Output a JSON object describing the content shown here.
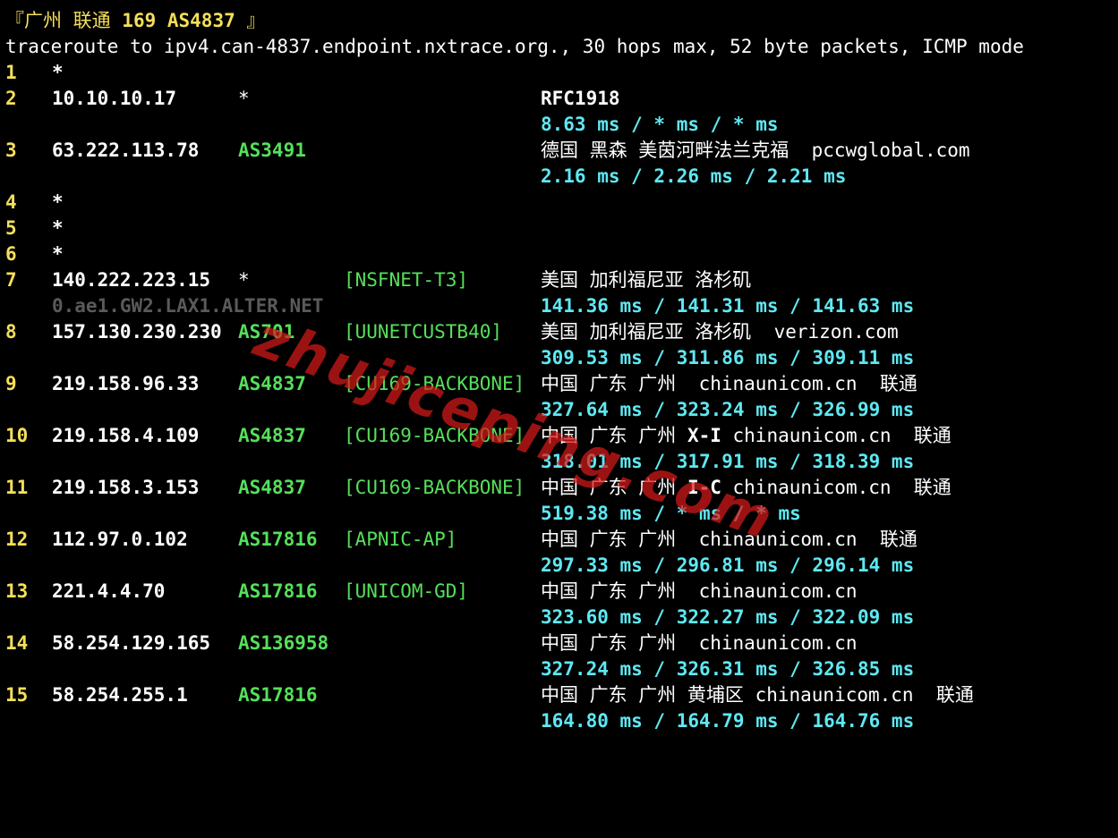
{
  "title": {
    "prefix": "『广州 联通 ",
    "bold": "169 AS4837",
    "suffix": " 』"
  },
  "header": "traceroute to ipv4.can-4837.endpoint.nxtrace.org., 30 hops max, 52 byte packets, ICMP mode",
  "watermark": "zhujiceping.com",
  "colors": {
    "hop_number": "#f5df5a",
    "asn": "#55e05a",
    "rtt": "#5ee8f2",
    "rdns": "#5a5a5a",
    "watermark": "#d71919"
  },
  "hops": [
    {
      "n": "1",
      "ip": "*"
    },
    {
      "n": "2",
      "ip": "10.10.10.17",
      "col2": "*",
      "label": "RFC1918",
      "rtt": "8.63 ms / * ms / * ms"
    },
    {
      "n": "3",
      "ip": "63.222.113.78",
      "asn": "AS3491",
      "geo": "德国 黑森 美茵河畔法兰克福  pccwglobal.com",
      "rtt": "2.16 ms / 2.26 ms / 2.21 ms"
    },
    {
      "n": "4",
      "ip": "*"
    },
    {
      "n": "5",
      "ip": "*"
    },
    {
      "n": "6",
      "ip": "*"
    },
    {
      "n": "7",
      "ip": "140.222.223.15",
      "col2": "*",
      "tag": "[NSFNET-T3]",
      "geo": "美国 加利福尼亚 洛杉矶",
      "rdns": "0.ae1.GW2.LAX1.ALTER.NET",
      "rtt": "141.36 ms / 141.31 ms / 141.63 ms"
    },
    {
      "n": "8",
      "ip": "157.130.230.230",
      "asn": "AS701",
      "tag": "[UUNETCUSTB40]",
      "geo": "美国 加利福尼亚 洛杉矶  verizon.com",
      "rtt": "309.53 ms / 311.86 ms / 309.11 ms"
    },
    {
      "n": "9",
      "ip": "219.158.96.33",
      "asn": "AS4837",
      "tag": "[CU169-BACKBONE]",
      "geo": "中国 广东 广州  chinaunicom.cn  联通",
      "rtt": "327.64 ms / 323.24 ms / 326.99 ms"
    },
    {
      "n": "10",
      "ip": "219.158.4.109",
      "asn": "AS4837",
      "tag": "[CU169-BACKBONE]",
      "geo_pre": "中国 广东 广州 ",
      "geo_bold": "X-I",
      "geo_post": " chinaunicom.cn  联通",
      "rtt": "318.01 ms / 317.91 ms / 318.39 ms"
    },
    {
      "n": "11",
      "ip": "219.158.3.153",
      "asn": "AS4837",
      "tag": "[CU169-BACKBONE]",
      "geo_pre": "中国 广东 广州 ",
      "geo_bold": "I-C",
      "geo_post": " chinaunicom.cn  联通",
      "rtt": "519.38 ms / * ms / * ms"
    },
    {
      "n": "12",
      "ip": "112.97.0.102",
      "asn": "AS17816",
      "tag": "[APNIC-AP]",
      "geo": "中国 广东 广州  chinaunicom.cn  联通",
      "rtt": "297.33 ms / 296.81 ms / 296.14 ms"
    },
    {
      "n": "13",
      "ip": "221.4.4.70",
      "asn": "AS17816",
      "tag": "[UNICOM-GD]",
      "geo": "中国 广东 广州  chinaunicom.cn",
      "rtt": "323.60 ms / 322.27 ms / 322.09 ms"
    },
    {
      "n": "14",
      "ip": "58.254.129.165",
      "asn": "AS136958",
      "geo": "中国 广东 广州  chinaunicom.cn",
      "rtt": "327.24 ms / 326.31 ms / 326.85 ms"
    },
    {
      "n": "15",
      "ip": "58.254.255.1",
      "asn": "AS17816",
      "geo": "中国 广东 广州 黄埔区 chinaunicom.cn  联通",
      "rtt": "164.80 ms / 164.79 ms / 164.76 ms"
    }
  ]
}
